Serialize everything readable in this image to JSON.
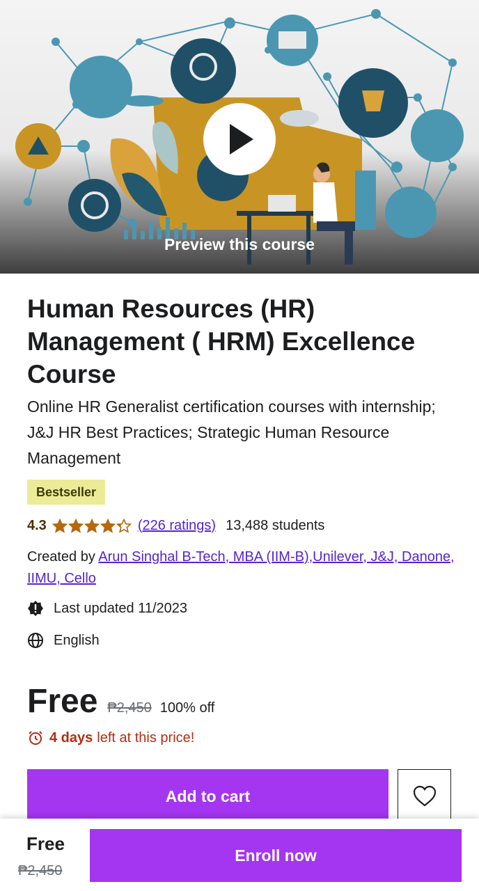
{
  "preview": {
    "label": "Preview this course",
    "icon": "play-icon"
  },
  "course": {
    "title": "Human Resources (HR) Management ( HRM) Excellence Course",
    "subtitle": "Online HR Generalist certification courses with internship; J&J HR Best Practices; Strategic Human Resource Management",
    "badge": "Bestseller",
    "rating": "4.3",
    "rating_value": 4.3,
    "rating_max": 5,
    "ratings_count": "(226 ratings)",
    "students": "13,488 students",
    "created_by_label": "Created by",
    "author": "Arun Singhal B-Tech, MBA (IIM-B),Unilever, J&J, Danone, IIMU, Cello",
    "last_updated": "Last updated 11/2023",
    "language": "English"
  },
  "pricing": {
    "current": "Free",
    "original": "₱2,450",
    "discount": "100% off",
    "timer_days": "4 days",
    "timer_text": "left at this price!"
  },
  "actions": {
    "add_to_cart": "Add to cart",
    "enroll_now": "Enroll now"
  },
  "bottom_bar": {
    "price": "Free",
    "original": "₱2,450"
  },
  "colors": {
    "primary": "#a435f0",
    "link": "#5624d0",
    "star": "#b4690e",
    "badge_bg": "#eceb98",
    "timer": "#b32d0f"
  }
}
